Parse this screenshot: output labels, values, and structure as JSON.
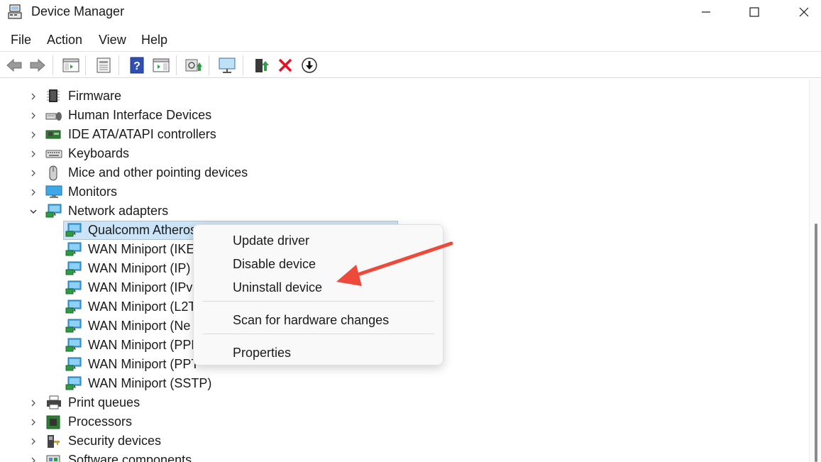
{
  "window": {
    "title": "Device Manager",
    "controls": [
      "minimize",
      "maximize",
      "close"
    ]
  },
  "menubar": {
    "items": [
      {
        "label": "File"
      },
      {
        "label": "Action"
      },
      {
        "label": "View"
      },
      {
        "label": "Help"
      }
    ]
  },
  "toolbar": {
    "buttons": [
      {
        "icon": "back-arrow-icon"
      },
      {
        "icon": "forward-arrow-icon"
      },
      {
        "icon": "show-hide-console-tree-icon"
      },
      {
        "icon": "properties-sheet-icon"
      },
      {
        "icon": "help-icon"
      },
      {
        "icon": "action-pane-icon"
      },
      {
        "icon": "scan-hardware-icon"
      },
      {
        "icon": "monitor-icon"
      },
      {
        "icon": "update-driver-icon"
      },
      {
        "icon": "uninstall-x-icon"
      },
      {
        "icon": "disable-device-icon"
      }
    ],
    "colors": {
      "uninstall_red": "#e81123",
      "update_green": "#2ba24a"
    }
  },
  "tree": {
    "rows": [
      {
        "label": "Firmware",
        "icon": "firmware-chip-icon",
        "expanded": false,
        "level": 0
      },
      {
        "label": "Human Interface Devices",
        "icon": "hid-icon",
        "expanded": false,
        "level": 0
      },
      {
        "label": "IDE ATA/ATAPI controllers",
        "icon": "ide-controller-icon",
        "expanded": false,
        "level": 0
      },
      {
        "label": "Keyboards",
        "icon": "keyboard-icon",
        "expanded": false,
        "level": 0
      },
      {
        "label": "Mice and other pointing devices",
        "icon": "mouse-icon",
        "expanded": false,
        "level": 0
      },
      {
        "label": "Monitors",
        "icon": "monitor-icon",
        "expanded": false,
        "level": 0
      },
      {
        "label": "Network adapters",
        "icon": "network-adapter-icon",
        "expanded": true,
        "level": 0
      },
      {
        "label": "Qualcomm Atheros",
        "icon": "network-adapter-icon",
        "level": 1,
        "selected": true
      },
      {
        "label": "WAN Miniport (IKE",
        "icon": "network-adapter-icon",
        "level": 1
      },
      {
        "label": "WAN Miniport (IP)",
        "icon": "network-adapter-icon",
        "level": 1
      },
      {
        "label": "WAN Miniport (IPv",
        "icon": "network-adapter-icon",
        "level": 1
      },
      {
        "label": "WAN Miniport (L2T",
        "icon": "network-adapter-icon",
        "level": 1
      },
      {
        "label": "WAN Miniport (Ne",
        "icon": "network-adapter-icon",
        "level": 1
      },
      {
        "label": "WAN Miniport (PPF",
        "icon": "network-adapter-icon",
        "level": 1
      },
      {
        "label": "WAN Miniport (PPT",
        "icon": "network-adapter-icon",
        "level": 1
      },
      {
        "label": "WAN Miniport (SSTP)",
        "icon": "network-adapter-icon",
        "level": 1
      },
      {
        "label": "Print queues",
        "icon": "printer-icon",
        "expanded": false,
        "level": 0
      },
      {
        "label": "Processors",
        "icon": "processor-icon",
        "expanded": false,
        "level": 0
      },
      {
        "label": "Security devices",
        "icon": "security-device-icon",
        "expanded": false,
        "level": 0
      },
      {
        "label": "Software components",
        "icon": "software-component-icon",
        "expanded": false,
        "level": 0
      }
    ]
  },
  "context_menu": {
    "items": [
      {
        "label": "Update driver"
      },
      {
        "label": "Disable device"
      },
      {
        "label": "Uninstall device"
      },
      {
        "label": "Scan for hardware changes"
      },
      {
        "label": "Properties"
      }
    ]
  },
  "annotation": {
    "arrow_color": "#ee4a3c",
    "points_to": "Uninstall device"
  }
}
